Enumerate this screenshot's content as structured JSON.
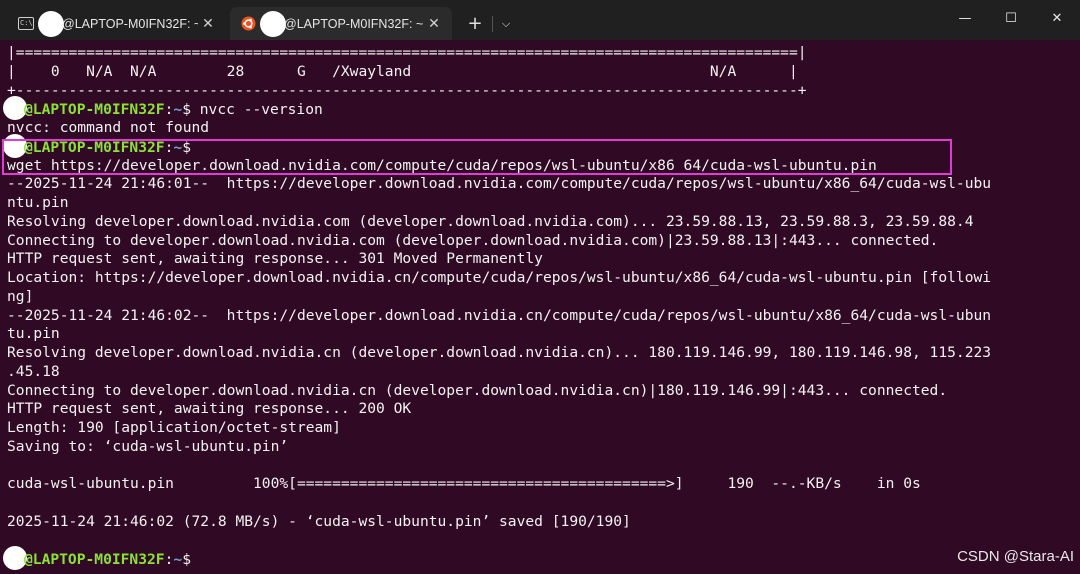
{
  "window": {
    "tabs": [
      {
        "title": "@LAPTOP-M0IFN32F: ~",
        "icon": "cmd-icon",
        "close": "✕",
        "active": false
      },
      {
        "title": "@LAPTOP-M0IFN32F: ~",
        "icon": "ubuntu-icon",
        "close": "✕",
        "active": true
      }
    ],
    "new_tab": "+",
    "dropdown": "⌵",
    "minimize": "—",
    "maximize": "☐",
    "close": "✕",
    "colors": {
      "terminal_bg": "#300a24",
      "titlebar_bg": "#202020",
      "prompt_user": "#8ae234",
      "prompt_path": "#729fcf",
      "highlight": "#e23ad6"
    }
  },
  "terminal": {
    "lines": [
      {
        "type": "text",
        "text": "|=========================================================================================|"
      },
      {
        "type": "text",
        "text": "|    0   N/A  N/A        28      G   /Xwayland                                  N/A      |"
      },
      {
        "type": "text",
        "text": "+-----------------------------------------------------------------------------------------+"
      },
      {
        "type": "prompt",
        "user": "@LAPTOP-M0IFN32F",
        "path": "~",
        "cmd": " nvcc --version"
      },
      {
        "type": "text",
        "text": "nvcc: command not found"
      },
      {
        "type": "prompt",
        "user": "@LAPTOP-M0IFN32F",
        "path": "~",
        "cmd": ""
      },
      {
        "type": "text",
        "text": "wget https://developer.download.nvidia.com/compute/cuda/repos/wsl-ubuntu/x86_64/cuda-wsl-ubuntu.pin"
      },
      {
        "type": "text",
        "text": "--2025-11-24 21:46:01--  https://developer.download.nvidia.com/compute/cuda/repos/wsl-ubuntu/x86_64/cuda-wsl-ubu"
      },
      {
        "type": "text",
        "text": "ntu.pin"
      },
      {
        "type": "text",
        "text": "Resolving developer.download.nvidia.com (developer.download.nvidia.com)... 23.59.88.13, 23.59.88.3, 23.59.88.4"
      },
      {
        "type": "text",
        "text": "Connecting to developer.download.nvidia.com (developer.download.nvidia.com)|23.59.88.13|:443... connected."
      },
      {
        "type": "text",
        "text": "HTTP request sent, awaiting response... 301 Moved Permanently"
      },
      {
        "type": "text",
        "text": "Location: https://developer.download.nvidia.cn/compute/cuda/repos/wsl-ubuntu/x86_64/cuda-wsl-ubuntu.pin [followi"
      },
      {
        "type": "text",
        "text": "ng]"
      },
      {
        "type": "text",
        "text": "--2025-11-24 21:46:02--  https://developer.download.nvidia.cn/compute/cuda/repos/wsl-ubuntu/x86_64/cuda-wsl-ubun"
      },
      {
        "type": "text",
        "text": "tu.pin"
      },
      {
        "type": "text",
        "text": "Resolving developer.download.nvidia.cn (developer.download.nvidia.cn)... 180.119.146.99, 180.119.146.98, 115.223"
      },
      {
        "type": "text",
        "text": ".45.18"
      },
      {
        "type": "text",
        "text": "Connecting to developer.download.nvidia.cn (developer.download.nvidia.cn)|180.119.146.99|:443... connected."
      },
      {
        "type": "text",
        "text": "HTTP request sent, awaiting response... 200 OK"
      },
      {
        "type": "text",
        "text": "Length: 190 [application/octet-stream]"
      },
      {
        "type": "text",
        "text": "Saving to: ‘cuda-wsl-ubuntu.pin’"
      },
      {
        "type": "text",
        "text": ""
      },
      {
        "type": "text",
        "text": "cuda-wsl-ubuntu.pin         100%[==========================================>]     190  --.-KB/s    in 0s"
      },
      {
        "type": "text",
        "text": ""
      },
      {
        "type": "text",
        "text": "2025-11-24 21:46:02 (72.8 MB/s) - ‘cuda-wsl-ubuntu.pin’ saved [190/190]"
      },
      {
        "type": "text",
        "text": ""
      },
      {
        "type": "prompt",
        "user": "@LAPTOP-M0IFN32F",
        "path": "~",
        "cmd": ""
      }
    ],
    "prompt_separator": ":",
    "prompt_symbol": "$"
  },
  "watermark": "CSDN @Stara-AI"
}
